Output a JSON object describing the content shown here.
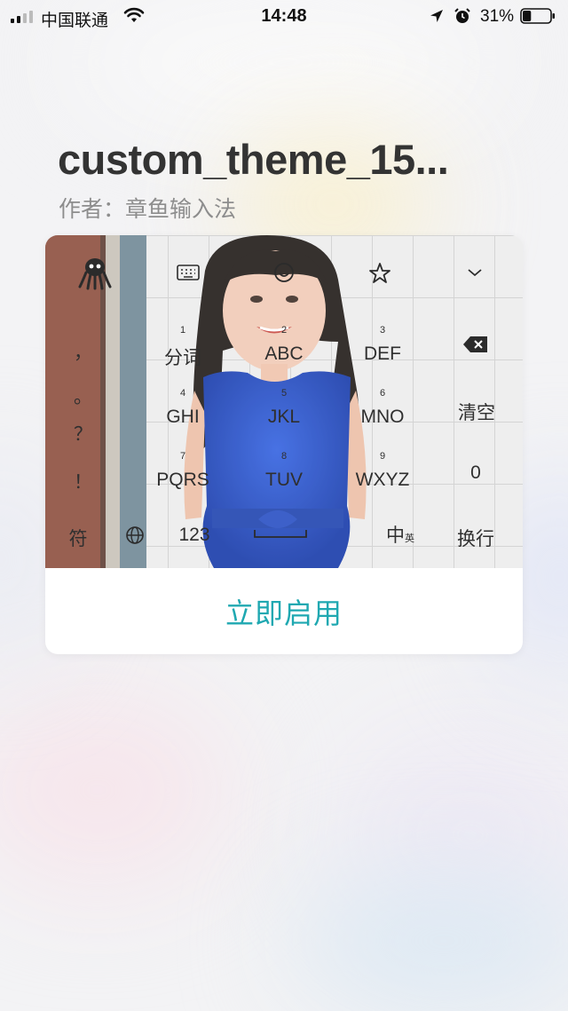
{
  "status_bar": {
    "carrier": "中国联通",
    "time": "14:48",
    "battery_percent": "31%",
    "battery_level": 0.31
  },
  "theme": {
    "title": "custom_theme_15...",
    "author": "作者：章鱼输入法"
  },
  "keyboard": {
    "left_column": [
      "，",
      "。",
      "？",
      "！"
    ],
    "keys": [
      {
        "num": "1",
        "label": "分词"
      },
      {
        "num": "2",
        "label": "ABC"
      },
      {
        "num": "3",
        "label": "DEF"
      },
      {
        "num": "4",
        "label": "GHI"
      },
      {
        "num": "5",
        "label": "JKL"
      },
      {
        "num": "6",
        "label": "MNO"
      },
      {
        "num": "7",
        "label": "PQRS"
      },
      {
        "num": "8",
        "label": "TUV"
      },
      {
        "num": "9",
        "label": "WXYZ"
      }
    ],
    "clear": "清空",
    "zero": "0",
    "symbol": "符",
    "num_switch": "123",
    "zh_switch": "中",
    "en_switch": "英",
    "enter": "换行"
  },
  "apply_button": "立即启用",
  "colors": {
    "accent": "#1fa8b1",
    "title": "#333333",
    "subtitle": "#8d8d8d"
  },
  "icons": [
    "cellular-signal-icon",
    "wifi-icon",
    "location-arrow-icon",
    "alarm-clock-icon",
    "battery-icon",
    "octopus-logo-icon",
    "keyboard-icon",
    "emoji-icon",
    "star-icon",
    "chevron-down-icon",
    "backspace-icon",
    "globe-icon",
    "space-bar-icon"
  ]
}
